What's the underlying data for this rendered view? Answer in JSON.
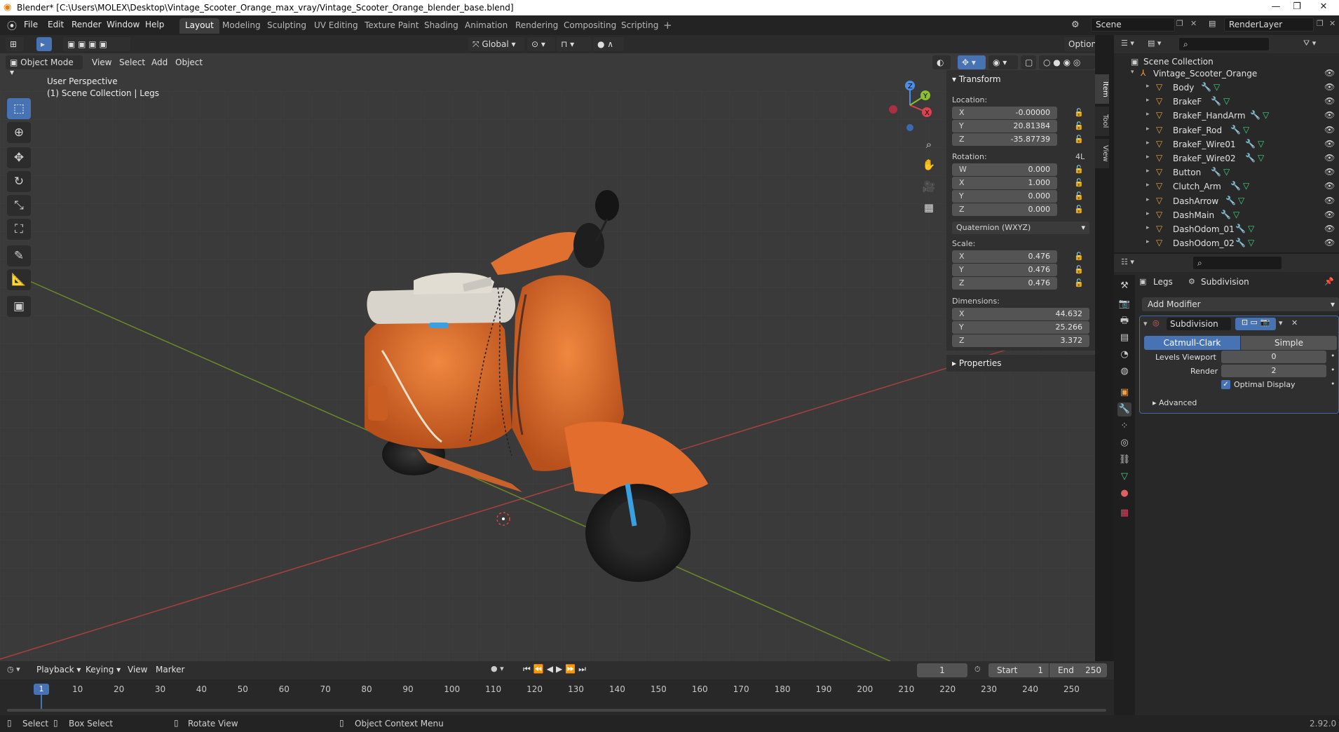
{
  "window": {
    "title": "Blender* [C:\\Users\\MOLEX\\Desktop\\Vintage_Scooter_Orange_max_vray/Vintage_Scooter_Orange_blender_base.blend]",
    "minimize": "—",
    "maximize": "❐",
    "close": "✕"
  },
  "menu": {
    "file": "File",
    "edit": "Edit",
    "render": "Render",
    "window": "Window",
    "help": "Help"
  },
  "workspaces": [
    "Layout",
    "Modeling",
    "Sculpting",
    "UV Editing",
    "Texture Paint",
    "Shading",
    "Animation",
    "Rendering",
    "Compositing",
    "Scripting"
  ],
  "scene": {
    "name": "Scene",
    "render_layer": "RenderLayer"
  },
  "viewport": {
    "transform_orientation": "Global",
    "options": "Options",
    "mode": "Object Mode",
    "view": "View",
    "select": "Select",
    "add": "Add",
    "object": "Object",
    "perspective": "User Perspective",
    "collection_info": "(1) Scene Collection | Legs",
    "gizmo": {
      "x": "X",
      "y": "Y",
      "z": "Z"
    }
  },
  "npanel": {
    "transform_title": "Transform",
    "location_label": "Location:",
    "location": [
      {
        "axis": "X",
        "value": "-0.00000"
      },
      {
        "axis": "Y",
        "value": "20.81384"
      },
      {
        "axis": "Z",
        "value": "-35.87739"
      }
    ],
    "rotation_label": "Rotation:",
    "rotation_lock": "4L",
    "rotation": [
      {
        "axis": "W",
        "value": "0.000"
      },
      {
        "axis": "X",
        "value": "1.000"
      },
      {
        "axis": "Y",
        "value": "0.000"
      },
      {
        "axis": "Z",
        "value": "0.000"
      }
    ],
    "rotation_mode": "Quaternion (WXYZ)",
    "scale_label": "Scale:",
    "scale": [
      {
        "axis": "X",
        "value": "0.476"
      },
      {
        "axis": "Y",
        "value": "0.476"
      },
      {
        "axis": "Z",
        "value": "0.476"
      }
    ],
    "dimensions_label": "Dimensions:",
    "dimensions": [
      {
        "axis": "X",
        "value": "44.632"
      },
      {
        "axis": "Y",
        "value": "25.266"
      },
      {
        "axis": "Z",
        "value": "3.372"
      }
    ],
    "properties_title": "Properties",
    "tabs": [
      "Item",
      "Tool",
      "View"
    ]
  },
  "outliner": {
    "root": "Scene Collection",
    "collection": "Vintage_Scooter_Orange",
    "items": [
      "Body",
      "BrakeF",
      "BrakeF_HandArm",
      "BrakeF_Rod",
      "BrakeF_Wire01",
      "BrakeF_Wire02",
      "Button",
      "Clutch_Arm",
      "DashArrow",
      "DashMain",
      "DashOdom_01",
      "DashOdom_02"
    ]
  },
  "properties": {
    "object_name": "Legs",
    "modifier_context": "Subdivision",
    "add_modifier": "Add Modifier",
    "modifier_name": "Subdivision",
    "catmull_clark": "Catmull-Clark",
    "simple": "Simple",
    "levels_viewport_label": "Levels Viewport",
    "levels_viewport": "0",
    "render_label": "Render",
    "render_levels": "2",
    "optimal_display": "Optimal Display",
    "advanced": "Advanced"
  },
  "timeline": {
    "playback": "Playback",
    "keying": "Keying",
    "view": "View",
    "marker": "Marker",
    "current_frame": "1",
    "start_label": "Start",
    "start": "1",
    "end_label": "End",
    "end": "250",
    "ticks": [
      "1",
      "10",
      "20",
      "30",
      "40",
      "50",
      "60",
      "70",
      "80",
      "90",
      "100",
      "110",
      "120",
      "130",
      "140",
      "150",
      "160",
      "170",
      "180",
      "190",
      "200",
      "210",
      "220",
      "230",
      "240",
      "250"
    ]
  },
  "status": {
    "select": "Select",
    "box_select": "Box Select",
    "rotate_view": "Rotate View",
    "context_menu": "Object Context Menu",
    "version": "2.92.0"
  },
  "colors": {
    "accent": "#4772b3",
    "orange": "#e06a2c",
    "viewport_bg": "#3a3a3a"
  }
}
